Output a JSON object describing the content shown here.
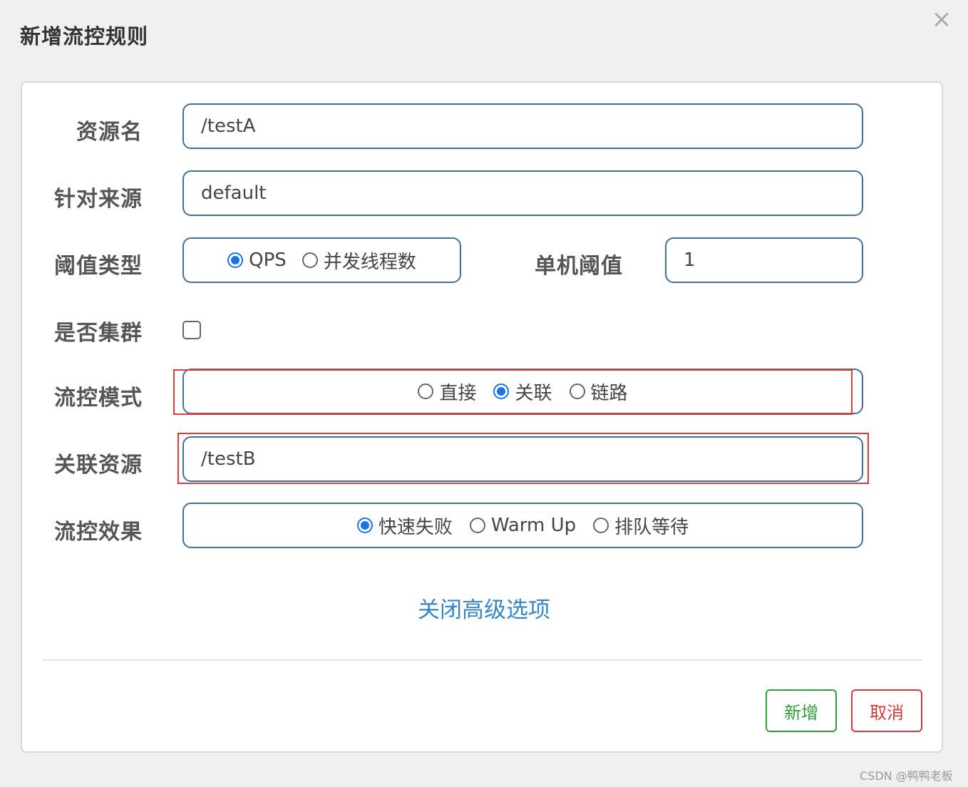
{
  "dialog": {
    "title": "新增流控规则",
    "close_symbol": "×"
  },
  "form": {
    "resource_name": {
      "label": "资源名",
      "value": "/testA"
    },
    "limit_app": {
      "label": "针对来源",
      "value": "default"
    },
    "threshold_type": {
      "label": "阈值类型",
      "options": [
        {
          "label": "QPS",
          "checked": true
        },
        {
          "label": "并发线程数",
          "checked": false
        }
      ]
    },
    "single_threshold": {
      "label": "单机阈值",
      "value": "1"
    },
    "cluster_mode": {
      "label": "是否集群",
      "checked": false
    },
    "strategy": {
      "label": "流控模式",
      "options": [
        {
          "label": "直接",
          "checked": false
        },
        {
          "label": "关联",
          "checked": true
        },
        {
          "label": "链路",
          "checked": false
        }
      ]
    },
    "ref_resource": {
      "label": "关联资源",
      "value": "/testB"
    },
    "control_behavior": {
      "label": "流控效果",
      "options": [
        {
          "label": "快速失败",
          "checked": true
        },
        {
          "label": "Warm Up",
          "checked": false
        },
        {
          "label": "排队等待",
          "checked": false
        }
      ]
    },
    "advanced_toggle": "关闭高级选项"
  },
  "footer": {
    "add_label": "新增",
    "cancel_label": "取消"
  },
  "watermark": "CSDN @鸭鸭老板",
  "colors": {
    "accent": "#1a73e8",
    "field_border": "#41709b",
    "highlight": "#e03c3c",
    "add": "#2e9e3a",
    "cancel": "#d43a3a",
    "link": "#3a86c5"
  }
}
